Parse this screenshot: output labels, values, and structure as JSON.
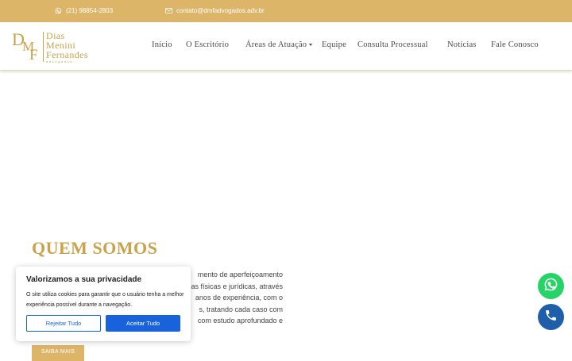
{
  "topbar": {
    "phone": "(21) 98854-2803",
    "email": "contato@dmfadvogados.adv.br"
  },
  "logo": {
    "monogram": {
      "d": "D",
      "m": "M",
      "f": "F"
    },
    "line1": "Dias",
    "line2": "Menini",
    "line3": "Fernandes",
    "tagline": "advogados"
  },
  "nav": {
    "items": [
      "Início",
      "O Escritório",
      "Áreas de Atuação",
      "Equipe",
      "Consulta Processual",
      "Notícias",
      "Fale Conosco"
    ]
  },
  "about": {
    "title": "QUEM SOMOS",
    "lines": [
      "mento de aperfeiçoamento",
      "oas físicas e jurídicas, através",
      "anos de experiência, com o",
      "s, tratando cada caso com",
      "com estudo aprofundado e"
    ],
    "button": "SAIBA MAIS"
  },
  "cookie": {
    "title": "Valorizamos a sua privacidade",
    "text": "O site utiliza cookies para garantir que o usuário tenha a melhor experiência possível durante a navegação.",
    "reject": "Rejeitar Tudo",
    "accept": "Aceitar Tudo"
  },
  "colors": {
    "gold": "#dcb569",
    "gold_text": "#c9a24a",
    "cookie_blue": "#1863dc",
    "whatsapp": "#25d366",
    "phone_button": "#1f5ea8"
  }
}
